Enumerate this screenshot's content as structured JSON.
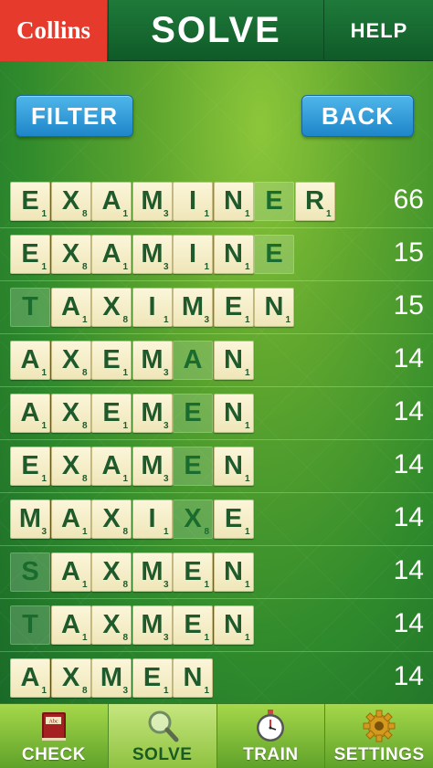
{
  "header": {
    "logo": "Collins",
    "title": "SOLVE",
    "help": "HELP"
  },
  "buttons": {
    "filter": "FILTER",
    "back": "BACK"
  },
  "results": [
    {
      "score": "66",
      "tiles": [
        [
          "E",
          "1",
          false
        ],
        [
          "X",
          "8",
          false
        ],
        [
          "A",
          "1",
          false
        ],
        [
          "M",
          "3",
          false
        ],
        [
          "I",
          "1",
          false
        ],
        [
          "N",
          "1",
          false
        ],
        [
          "E",
          "",
          true
        ],
        [
          "R",
          "1",
          false
        ]
      ]
    },
    {
      "score": "15",
      "tiles": [
        [
          "E",
          "1",
          false
        ],
        [
          "X",
          "8",
          false
        ],
        [
          "A",
          "1",
          false
        ],
        [
          "M",
          "3",
          false
        ],
        [
          "I",
          "1",
          false
        ],
        [
          "N",
          "1",
          false
        ],
        [
          "E",
          "",
          true
        ]
      ]
    },
    {
      "score": "15",
      "tiles": [
        [
          "T",
          "",
          true
        ],
        [
          "A",
          "1",
          false
        ],
        [
          "X",
          "8",
          false
        ],
        [
          "I",
          "1",
          false
        ],
        [
          "M",
          "3",
          false
        ],
        [
          "E",
          "1",
          false
        ],
        [
          "N",
          "1",
          false
        ]
      ]
    },
    {
      "score": "14",
      "tiles": [
        [
          "A",
          "1",
          false
        ],
        [
          "X",
          "8",
          false
        ],
        [
          "E",
          "1",
          false
        ],
        [
          "M",
          "3",
          false
        ],
        [
          "A",
          "",
          true
        ],
        [
          "N",
          "1",
          false
        ]
      ]
    },
    {
      "score": "14",
      "tiles": [
        [
          "A",
          "1",
          false
        ],
        [
          "X",
          "8",
          false
        ],
        [
          "E",
          "1",
          false
        ],
        [
          "M",
          "3",
          false
        ],
        [
          "E",
          "",
          true
        ],
        [
          "N",
          "1",
          false
        ]
      ]
    },
    {
      "score": "14",
      "tiles": [
        [
          "E",
          "1",
          false
        ],
        [
          "X",
          "8",
          false
        ],
        [
          "A",
          "1",
          false
        ],
        [
          "M",
          "3",
          false
        ],
        [
          "E",
          "",
          true
        ],
        [
          "N",
          "1",
          false
        ]
      ]
    },
    {
      "score": "14",
      "tiles": [
        [
          "M",
          "3",
          false
        ],
        [
          "A",
          "1",
          false
        ],
        [
          "X",
          "8",
          false
        ],
        [
          "I",
          "1",
          false
        ],
        [
          "X",
          "8",
          true
        ],
        [
          "E",
          "1",
          false
        ]
      ]
    },
    {
      "score": "14",
      "tiles": [
        [
          "S",
          "",
          true
        ],
        [
          "A",
          "1",
          false
        ],
        [
          "X",
          "8",
          false
        ],
        [
          "M",
          "3",
          false
        ],
        [
          "E",
          "1",
          false
        ],
        [
          "N",
          "1",
          false
        ]
      ]
    },
    {
      "score": "14",
      "tiles": [
        [
          "T",
          "",
          true
        ],
        [
          "A",
          "1",
          false
        ],
        [
          "X",
          "8",
          false
        ],
        [
          "M",
          "3",
          false
        ],
        [
          "E",
          "1",
          false
        ],
        [
          "N",
          "1",
          false
        ]
      ]
    },
    {
      "score": "14",
      "tiles": [
        [
          "A",
          "1",
          false
        ],
        [
          "X",
          "8",
          false
        ],
        [
          "M",
          "3",
          false
        ],
        [
          "E",
          "1",
          false
        ],
        [
          "N",
          "1",
          false
        ]
      ]
    }
  ],
  "tabs": [
    {
      "label": "CHECK",
      "icon": "dictionary-book-icon"
    },
    {
      "label": "SOLVE",
      "icon": "magnifier-icon"
    },
    {
      "label": "TRAIN",
      "icon": "stopwatch-icon"
    },
    {
      "label": "SETTINGS",
      "icon": "gear-icon"
    }
  ],
  "colors": {
    "logo_bg": "#e53a2c",
    "header_bg": "#1f7a3a",
    "button_blue": "#2b97d6",
    "tile_bg": "#fbf6da",
    "tile_text": "#1f5a2c"
  }
}
